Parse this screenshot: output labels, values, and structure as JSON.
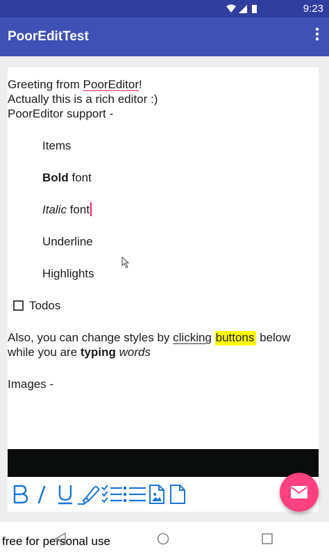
{
  "status_bar": {
    "time": "9:23",
    "icons": [
      "wifi-icon",
      "signal-icon",
      "battery-icon"
    ]
  },
  "app_bar": {
    "title": "PoorEditTest",
    "overflow_icon": "more-vert-icon"
  },
  "editor": {
    "greeting_prefix": "Greeting from ",
    "greeting_link": "PoorEditor",
    "greeting_suffix": "!",
    "line2": "Actually this is a rich editor :)",
    "line3": "PoorEditor support -",
    "items": "Items",
    "bold_word": "Bold",
    "bold_rest": " font",
    "italic_word": "Italic",
    "italic_rest": " font",
    "underline": "Underline",
    "highlights": "Highlights",
    "todos": "Todos",
    "also_1": "Also, you can change styles by ",
    "also_clicking": "clicking",
    "also_buttons": "buttons",
    "also_2": " below",
    "while_1": "while you are ",
    "while_typing": "typing",
    "while_words": "words",
    "images_label": "Images -"
  },
  "toolbar": {
    "buttons": [
      "bold-icon",
      "italic-icon",
      "underline-icon",
      "highlight-icon",
      "checklist-icon",
      "bulleted-list-icon",
      "insert-image-icon",
      "new-document-icon"
    ],
    "accent": "#1976d2"
  },
  "fab": {
    "icon": "email-icon",
    "color": "#ff4081"
  },
  "colors": {
    "primary": "#3f51b5",
    "primary_dark": "#303f9f",
    "background": "#eeeeee"
  },
  "watermark": "free for personal use",
  "nav_bar": {
    "buttons": [
      "back-icon",
      "home-icon",
      "recents-icon"
    ]
  }
}
